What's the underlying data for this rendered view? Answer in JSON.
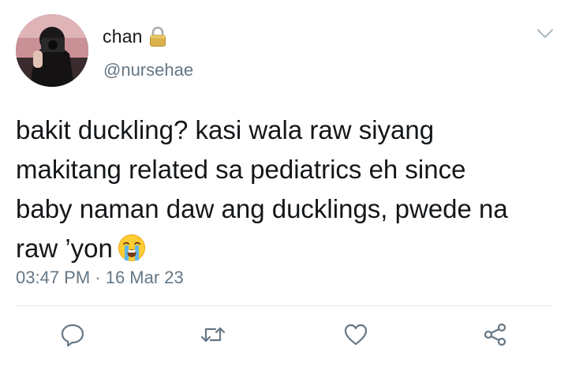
{
  "user": {
    "display_name": "chan",
    "handle": "@nursehae",
    "protected_icon": "lock-icon"
  },
  "tweet": {
    "lines": [
      "bakit duckling? kasi wala raw siyang",
      "makitang related sa pediatrics eh since",
      "baby naman daw ang ducklings, pwede na",
      "raw ’yon"
    ],
    "emoji": "loudly-crying-face-emoji",
    "timestamp": "03:47 PM · 16 Mar 23"
  },
  "actions": {
    "reply_icon": "reply-icon",
    "retweet_icon": "retweet-icon",
    "like_icon": "heart-icon",
    "share_icon": "share-icon"
  },
  "colors": {
    "text": "#14171a",
    "secondary": "#657786",
    "divider": "#e1e8ed",
    "icon": "#657786"
  }
}
